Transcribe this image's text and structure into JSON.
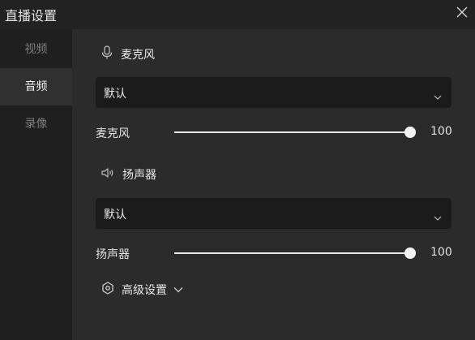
{
  "window": {
    "title": "直播设置",
    "close_icon": "close-icon"
  },
  "sidebar": {
    "items": [
      {
        "label": "视频",
        "active": false
      },
      {
        "label": "音频",
        "active": true
      },
      {
        "label": "录像",
        "active": false
      }
    ]
  },
  "microphone": {
    "section_title": "麦克风",
    "icon": "microphone-icon",
    "device_value": "默认",
    "volume_label": "麦克风",
    "volume_value": "100",
    "volume_level": 100
  },
  "speaker": {
    "section_title": "扬声器",
    "icon": "speaker-icon",
    "device_value": "默认",
    "volume_label": "扬声器",
    "volume_value": "100",
    "volume_level": 100
  },
  "advanced": {
    "label": "高级设置",
    "icon": "settings-hexagon-icon"
  },
  "colors": {
    "background": "#2b2b2b",
    "titlebar": "#222222",
    "sidebar": "#1f1f1f",
    "sidebar_active": "#303030",
    "select_bg": "#1b1b1b",
    "text": "#e6e6e6",
    "text_muted": "#7d7d7d"
  }
}
